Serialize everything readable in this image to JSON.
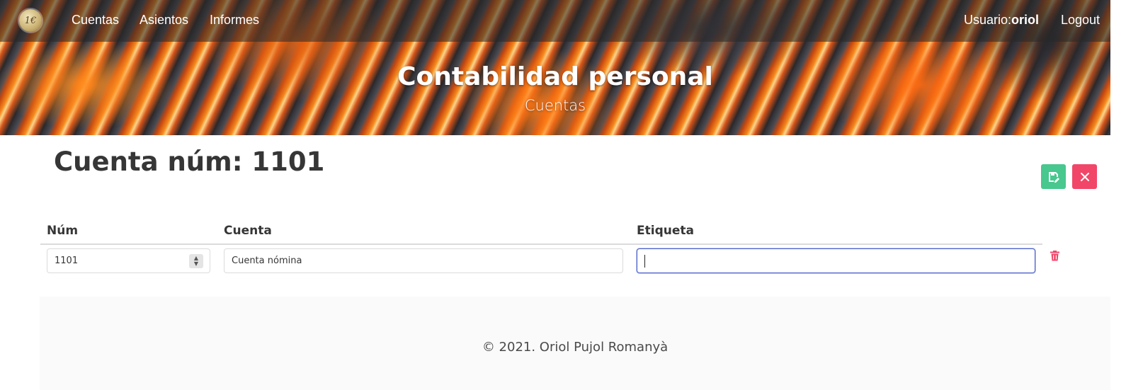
{
  "navbar": {
    "logo_text": "1€",
    "links": [
      "Cuentas",
      "Asientos",
      "Informes"
    ],
    "user_prefix": "Usuario:",
    "user_name": "oriol",
    "logout": "Logout"
  },
  "hero": {
    "title": "Contabilidad personal",
    "subtitle": "Cuentas"
  },
  "page": {
    "title": "Cuenta núm: 1101"
  },
  "toolbar": {
    "save_icon": "save-icon",
    "close_icon": "close-icon",
    "save_color": "#48c78e",
    "close_color": "#f14668"
  },
  "table": {
    "headers": [
      "Núm",
      "Cuenta",
      "Etiqueta"
    ],
    "row": {
      "num": "1101",
      "cuenta": "Cuenta nómina",
      "etiqueta": ""
    },
    "delete_icon": "trash-icon",
    "delete_color": "#f14668"
  },
  "footer": {
    "text": "© 2021. Oriol Pujol Romanyà"
  },
  "colors": {
    "focus_border": "#485fc7",
    "footer_bg": "#fafafa"
  }
}
